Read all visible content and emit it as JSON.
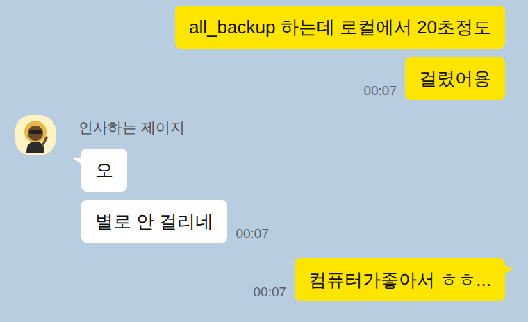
{
  "thread": [
    {
      "kind": "sent-group",
      "messages": [
        {
          "text": "all_backup 하는데 로컬에서 20초정도",
          "tail": false
        },
        {
          "text": "걸렸어용",
          "time": "00:07",
          "tail": false
        }
      ]
    },
    {
      "kind": "received-group",
      "sender": "인사하는 제이지",
      "messages": [
        {
          "text": "오",
          "tail": true
        },
        {
          "text": "별로 안 걸리네",
          "time": "00:07",
          "tail": false
        }
      ]
    },
    {
      "kind": "sent-group",
      "messages": [
        {
          "text": "컴퓨터가좋아서 ㅎㅎ...",
          "time": "00:07",
          "tail": true
        }
      ]
    }
  ]
}
